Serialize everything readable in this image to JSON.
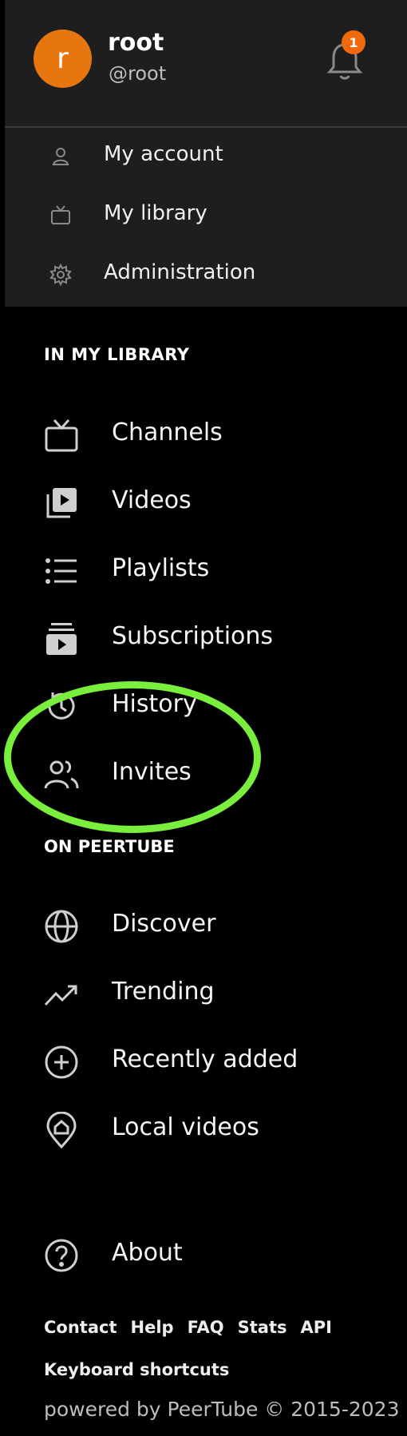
{
  "user": {
    "avatar_letter": "r",
    "name": "root",
    "handle": "@root",
    "notification_count": "1",
    "avatar_color": "#e8760f"
  },
  "user_menu": [
    {
      "label": "My account",
      "icon": "user-icon"
    },
    {
      "label": "My library",
      "icon": "tv-icon"
    },
    {
      "label": "Administration",
      "icon": "gear-icon"
    }
  ],
  "sections": {
    "library_title": "IN MY LIBRARY",
    "peertube_title": "ON PEERTUBE"
  },
  "library_items": [
    {
      "label": "Channels",
      "icon": "tv-icon"
    },
    {
      "label": "Videos",
      "icon": "video-stack-icon"
    },
    {
      "label": "Playlists",
      "icon": "list-icon"
    },
    {
      "label": "Subscriptions",
      "icon": "subscriptions-icon"
    },
    {
      "label": "History",
      "icon": "history-icon"
    },
    {
      "label": "Invites",
      "icon": "users-icon"
    }
  ],
  "peertube_items": [
    {
      "label": "Discover",
      "icon": "globe-icon"
    },
    {
      "label": "Trending",
      "icon": "trending-icon"
    },
    {
      "label": "Recently added",
      "icon": "plus-circle-icon"
    },
    {
      "label": "Local videos",
      "icon": "home-pin-icon"
    }
  ],
  "about": {
    "label": "About",
    "icon": "question-circle-icon"
  },
  "footer": {
    "links": [
      "Contact",
      "Help",
      "FAQ",
      "Stats",
      "API"
    ],
    "keyboard_shortcuts": "Keyboard shortcuts",
    "powered_by": "powered by PeerTube © 2015-2023"
  },
  "colors": {
    "accent": "#f1680d",
    "highlight": "#79ee3c",
    "panel": "#1e1e1e"
  }
}
